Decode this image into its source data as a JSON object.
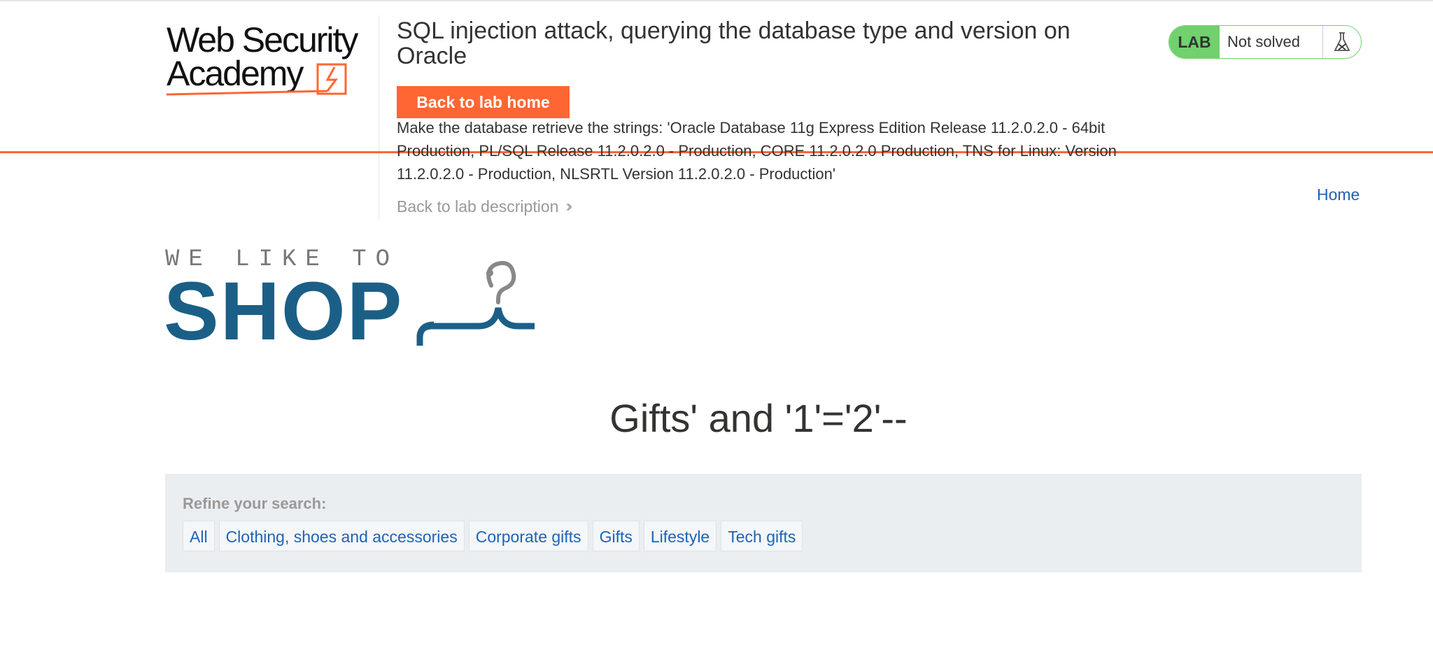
{
  "academy_logo": {
    "line1": "Web Security",
    "line2": "Academy"
  },
  "lab": {
    "title": "SQL injection attack, querying the database type and version on Oracle",
    "back_home_label": "Back to lab home",
    "description": "Make the database retrieve the strings: 'Oracle Database 11g Express Edition Release 11.2.0.2.0 - 64bit Production, PL/SQL Release 11.2.0.2.0 - Production, CORE 11.2.0.2.0 Production, TNS for Linux: Version 11.2.0.2.0 - Production, NLSRTL Version 11.2.0.2.0 - Production'",
    "back_description_label": "Back to lab description",
    "status_badge": "LAB",
    "status_text": "Not solved"
  },
  "nav": {
    "home_label": "Home"
  },
  "shop_logo": {
    "tagline": "WE LIKE TO",
    "word": "SHOP"
  },
  "page": {
    "heading": "Gifts' and '1'='2'--"
  },
  "filters": {
    "refine_label": "Refine your search:",
    "items": [
      "All",
      "Clothing, shoes and accessories",
      "Corporate gifts",
      "Gifts",
      "Lifestyle",
      "Tech gifts"
    ]
  },
  "colors": {
    "accent": "#ff6633",
    "status_green": "#70d16d",
    "link": "#1f63b4",
    "shop_blue": "#1b5f87"
  }
}
